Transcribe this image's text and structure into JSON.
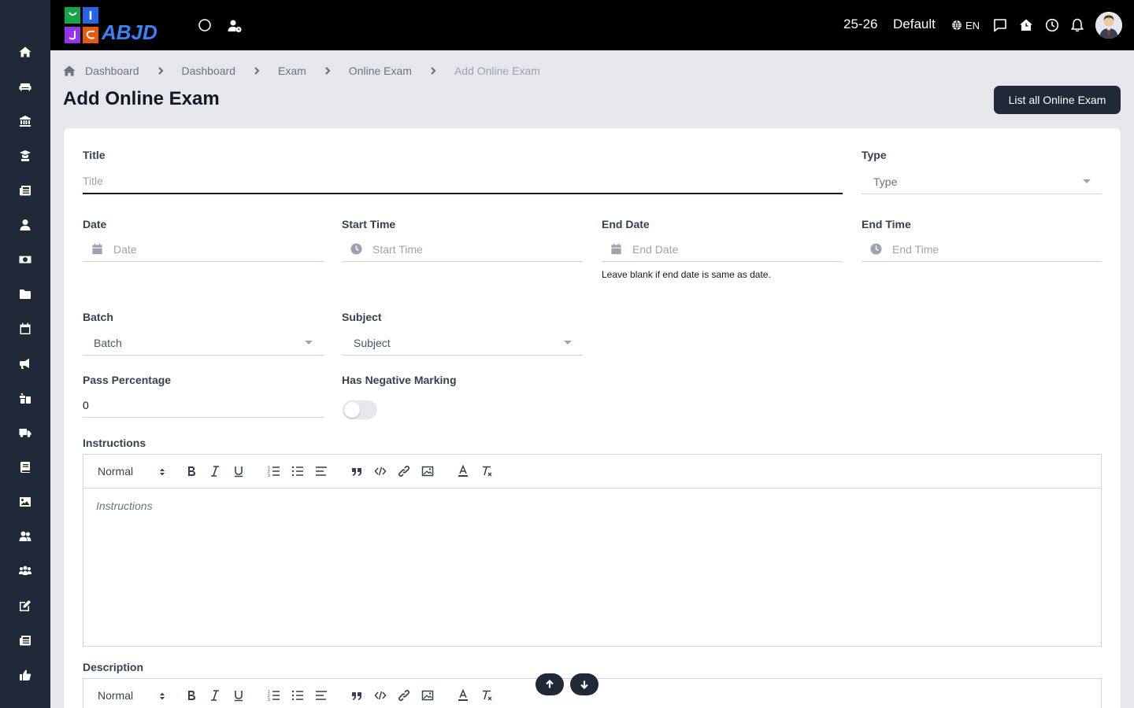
{
  "topbar": {
    "session": "25-26",
    "profile": "Default",
    "language": "EN",
    "logo_text": "ABJD"
  },
  "sidebar": {
    "items": [
      {
        "name": "home-icon"
      },
      {
        "name": "sofa-icon"
      },
      {
        "name": "institution-icon"
      },
      {
        "name": "student-icon"
      },
      {
        "name": "newspaper-icon"
      },
      {
        "name": "user-tie-icon"
      },
      {
        "name": "money-icon"
      },
      {
        "name": "folder-icon"
      },
      {
        "name": "calendar-icon"
      },
      {
        "name": "megaphone-icon"
      },
      {
        "name": "gifts-icon"
      },
      {
        "name": "truck-icon"
      },
      {
        "name": "book-icon"
      },
      {
        "name": "image-icon"
      },
      {
        "name": "users-icon"
      },
      {
        "name": "people-group-icon"
      },
      {
        "name": "edit-icon"
      },
      {
        "name": "news-icon"
      },
      {
        "name": "thumbs-up-icon"
      }
    ]
  },
  "breadcrumb": {
    "items": [
      "Dashboard",
      "Dashboard",
      "Exam",
      "Online Exam"
    ],
    "current": "Add Online Exam"
  },
  "page": {
    "title": "Add Online Exam",
    "list_button": "List all Online Exam"
  },
  "form": {
    "title": {
      "label": "Title",
      "placeholder": "Title"
    },
    "type": {
      "label": "Type",
      "placeholder": "Type"
    },
    "date": {
      "label": "Date",
      "placeholder": "Date"
    },
    "start_time": {
      "label": "Start Time",
      "placeholder": "Start Time"
    },
    "end_date": {
      "label": "End Date",
      "placeholder": "End Date",
      "help": "Leave blank if end date is same as date."
    },
    "end_time": {
      "label": "End Time",
      "placeholder": "End Time"
    },
    "batch": {
      "label": "Batch",
      "placeholder": "Batch"
    },
    "subject": {
      "label": "Subject",
      "placeholder": "Subject"
    },
    "pass_percentage": {
      "label": "Pass Percentage",
      "value": "0"
    },
    "negative_marking": {
      "label": "Has Negative Marking",
      "enabled": false
    },
    "instructions": {
      "label": "Instructions",
      "format": "Normal",
      "placeholder": "Instructions"
    },
    "description": {
      "label": "Description",
      "format": "Normal"
    }
  },
  "colors": {
    "sidebar": "#1f2937",
    "topbar": "#000000",
    "accent": "#1f2937",
    "background": "#e5e7eb"
  }
}
